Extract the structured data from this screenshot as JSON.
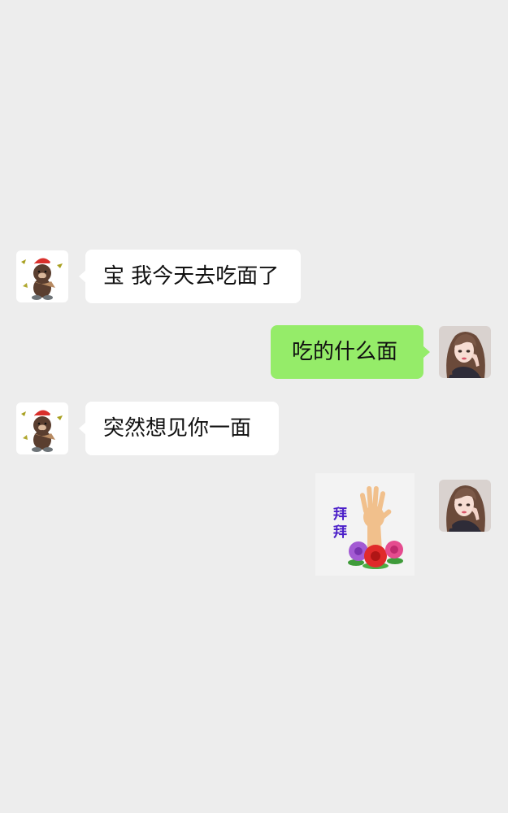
{
  "messages": [
    {
      "direction": "in",
      "type": "text",
      "text": "宝 我今天去吃面了"
    },
    {
      "direction": "out",
      "type": "text",
      "text": "吃的什么面"
    },
    {
      "direction": "in",
      "type": "text",
      "text": "突然想见你一面"
    },
    {
      "direction": "out",
      "type": "sticker",
      "sticker_text": "拜拜",
      "icon": "waving-hand-flowers-sticker"
    }
  ],
  "colors": {
    "background": "#ededed",
    "incoming_bubble": "#ffffff",
    "outgoing_bubble": "#95ec69"
  },
  "avatars": {
    "contact": "bear-avatar-icon",
    "self": "girl-avatar-icon"
  }
}
